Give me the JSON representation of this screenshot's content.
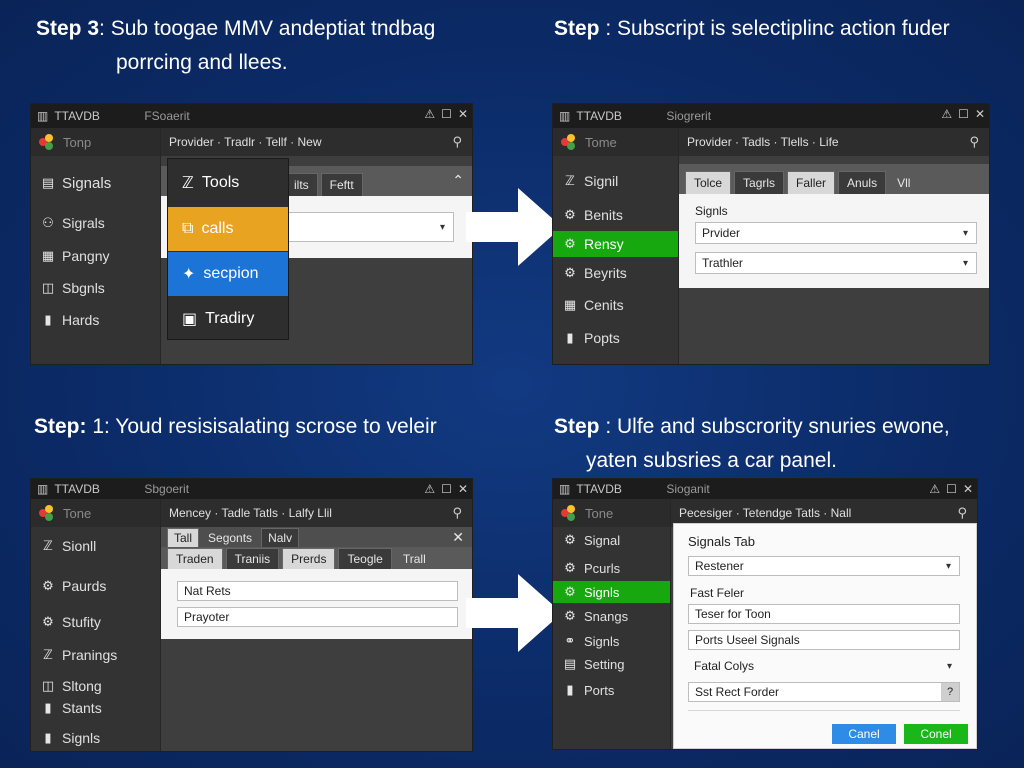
{
  "captions": {
    "top_left": {
      "step": "Step 3",
      "rest": ": Sub toogae MMV andeptiat tndbag",
      "line2": "porrcing and llees."
    },
    "top_right": {
      "step": "Step",
      "rest": " : Subscript is selectiplinc action fuder"
    },
    "bottom_left": {
      "step": "Step:",
      "rest": " 1: Youd resisisalating scrose to veleir"
    },
    "bottom_right": {
      "step": "Step",
      "rest": " : Ulfe and subscrority snuries ewone,",
      "line2": "yaten subsries a car panel."
    }
  },
  "win1": {
    "title": "TTAVDB",
    "subtitle": "FSoaerit",
    "sidebar_top": "Tonp",
    "breadcrumb": "Provider · Tradlr · Tellf · New",
    "sidebar": [
      "Signals",
      "Sigrals",
      "Pangny",
      "Sbgnls",
      "Hards"
    ],
    "sidebar_icons": [
      "▤",
      "⚇",
      "▦",
      "◫",
      "▮"
    ],
    "tabs": [
      "ilts",
      "Feftt"
    ],
    "popup": [
      "Tools",
      "calls",
      "secpion",
      "Tradiry"
    ],
    "popup_icons": [
      "ℤ",
      "⧉",
      "✦",
      "▣"
    ],
    "colors": {
      "popup_orange": "#e8a320",
      "popup_blue": "#1b74d6"
    }
  },
  "win2": {
    "title": "TTAVDB",
    "subtitle": "Siogrerit",
    "sidebar_top": "Tome",
    "breadcrumb": "Provider · Tadls · Tlells · Life",
    "sidebar": [
      "Signil",
      "Benits",
      "Rensy",
      "Beyrits",
      "Cenits",
      "Popts"
    ],
    "sidebar_icons": [
      "ℤ",
      "⚙",
      "⚙",
      "⚙",
      "▦",
      "▮"
    ],
    "tabs": [
      "Tolce",
      "Tagrls",
      "Faller",
      "Anuls",
      "Vll"
    ],
    "section_label": "Signls",
    "fields": [
      "Prvider",
      "Trathler"
    ],
    "active_index": 2
  },
  "win3": {
    "title": "TTAVDB",
    "subtitle": "Sbgoerit",
    "sidebar_top": "Tone",
    "breadcrumb": "Mencey · Tadle Tatls · Lalfy Llil",
    "sidebar": [
      "Sionll",
      "Paurds",
      "Stufity",
      "Pranings",
      "Sltong",
      "Stants",
      "Signls"
    ],
    "sidebar_icons": [
      "ℤ",
      "⚙",
      "⚙",
      "ℤ",
      "◫",
      "▮",
      "▮"
    ],
    "tabs_top": [
      "Tall",
      "Segonts",
      "Nalv"
    ],
    "tabs_bottom": [
      "Traden",
      "Traniis",
      "Prerds",
      "Teogle",
      "Trall"
    ],
    "fields": [
      "Nat Rets",
      "Prayoter"
    ]
  },
  "win4": {
    "title": "TTAVDB",
    "subtitle": "Sioganit",
    "sidebar_top": "Tone",
    "breadcrumb": "Pecesiger · Tetendge Tatls · Nall",
    "sidebar": [
      "Signal",
      "Pcurls",
      "Signls",
      "Snangs",
      "Signls",
      "Setting",
      "Ports"
    ],
    "sidebar_icons": [
      "⚙",
      "⚙",
      "⚙",
      "⚙",
      "⚭",
      "▤",
      "▮"
    ],
    "active_index": 2,
    "panel_title": "Signals Tab",
    "field1": "Restener",
    "label2": "Fast Feler",
    "field2": "Teser for Toon",
    "field3": "Ports Useel Signals",
    "label4": "Fatal Colys",
    "field5": "Sst Rect Forder",
    "cancel": "Canel",
    "confirm": "Conel",
    "colors": {
      "cancel": "#2e8be6",
      "confirm": "#19b71a"
    }
  }
}
